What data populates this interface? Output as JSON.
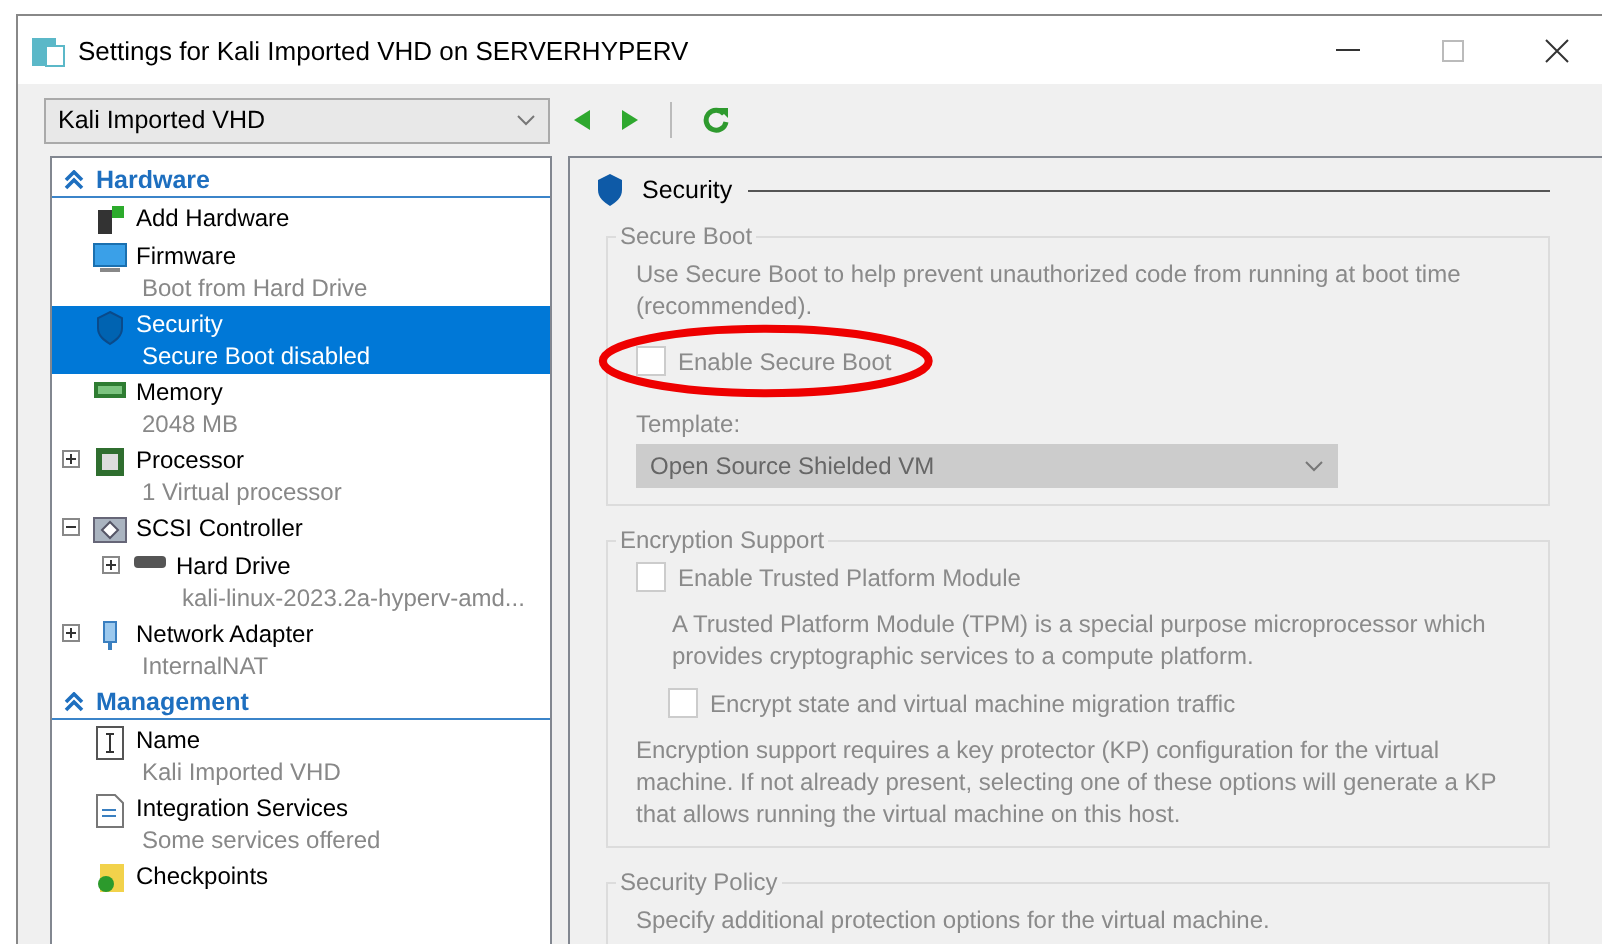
{
  "window": {
    "title": "Settings for Kali Imported VHD on SERVERHYPERV"
  },
  "vm_selector": {
    "value": "Kali Imported VHD"
  },
  "tree": {
    "sections": [
      {
        "title": "Hardware",
        "expanded": true,
        "items": [
          {
            "kind": "add",
            "label": "Add Hardware",
            "selected": false
          },
          {
            "kind": "firmware",
            "label": "Firmware",
            "detail": "Boot from Hard Drive",
            "selected": false
          },
          {
            "kind": "security",
            "label": "Security",
            "detail": "Secure Boot disabled",
            "selected": true
          },
          {
            "kind": "memory",
            "label": "Memory",
            "detail": "2048 MB",
            "selected": false
          },
          {
            "kind": "processor",
            "label": "Processor",
            "detail": "1 Virtual processor",
            "selected": false,
            "expanded": false
          },
          {
            "kind": "controller",
            "label": "SCSI Controller",
            "selected": false,
            "expanded": true,
            "children": [
              {
                "kind": "drive",
                "label": "Hard Drive",
                "detail": "kali-linux-2023.2a-hyperv-amd...",
                "selected": false,
                "expanded": false
              }
            ]
          },
          {
            "kind": "network",
            "label": "Network Adapter",
            "detail": "InternalNAT",
            "selected": false,
            "expanded": false
          }
        ]
      },
      {
        "title": "Management",
        "expanded": true,
        "items": [
          {
            "kind": "name",
            "label": "Name",
            "detail": "Kali Imported VHD",
            "selected": false
          },
          {
            "kind": "integration",
            "label": "Integration Services",
            "detail": "Some services offered",
            "selected": false
          },
          {
            "kind": "checkpoint",
            "label": "Checkpoints",
            "selected": false
          }
        ]
      }
    ]
  },
  "panel": {
    "title": "Security",
    "secure_boot": {
      "legend": "Secure Boot",
      "disabled": true,
      "description": "Use Secure Boot to help prevent unauthorized code from running at boot time (recommended).",
      "checkbox": {
        "label": "Enable Secure Boot",
        "checked": false
      },
      "template_label": "Template:",
      "template": "Open Source Shielded VM"
    },
    "encryption": {
      "legend": "Encryption Support",
      "tpm": {
        "label": "Enable Trusted Platform Module",
        "checked": false
      },
      "tpm_description": "A Trusted Platform Module (TPM) is a special purpose microprocessor which provides cryptographic services to a compute platform.",
      "encrypt": {
        "label": "Encrypt state and virtual machine migration traffic",
        "checked": false
      },
      "note": "Encryption support requires a key protector (KP) configuration for the virtual machine. If not already present, selecting one of these options will generate a KP that allows running the virtual machine on this host."
    },
    "policy": {
      "legend": "Security Policy",
      "description": "Specify additional protection options for the virtual machine."
    }
  }
}
